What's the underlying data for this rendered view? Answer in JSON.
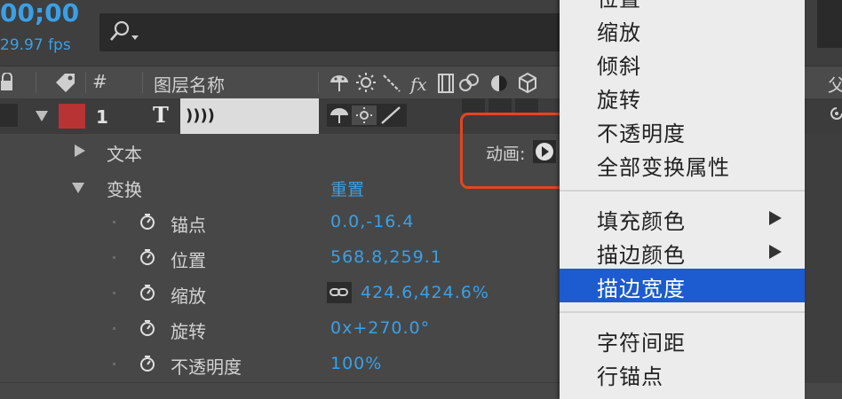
{
  "timecode": {
    "value": "00;00",
    "fps": "29.97 fps"
  },
  "search": {
    "placeholder": ""
  },
  "header": {
    "hash": "#",
    "layer_name": "图层名称",
    "right_label": "父"
  },
  "layer": {
    "number": "1",
    "type_glyph": "T",
    "name": "))))"
  },
  "rows": {
    "text": {
      "label": "文本",
      "animate": "动画:"
    },
    "transform": {
      "label": "变换",
      "reset": "重置"
    },
    "anchor": {
      "label": "锚点",
      "value": "0.0,-16.4"
    },
    "position": {
      "label": "位置",
      "value": "568.8,259.1"
    },
    "scale": {
      "label": "缩放",
      "value": "424.6,424.6%"
    },
    "rotation": {
      "label": "旋转",
      "value": "0x+270.0°"
    },
    "opacity": {
      "label": "不透明度",
      "value": "100%"
    }
  },
  "menu": {
    "items": [
      "位置",
      "缩放",
      "倾斜",
      "旋转",
      "不透明度",
      "全部变换属性"
    ],
    "items2": [
      "填充颜色",
      "描边颜色",
      "描边宽度"
    ],
    "items3": [
      "字符间距",
      "行锚点"
    ],
    "selected": "描边宽度"
  },
  "colors": {
    "accent": "#3aa0e6",
    "menu_highlight": "#1c5bd0",
    "callout": "#e7441f",
    "layer_label": "#b83333"
  }
}
